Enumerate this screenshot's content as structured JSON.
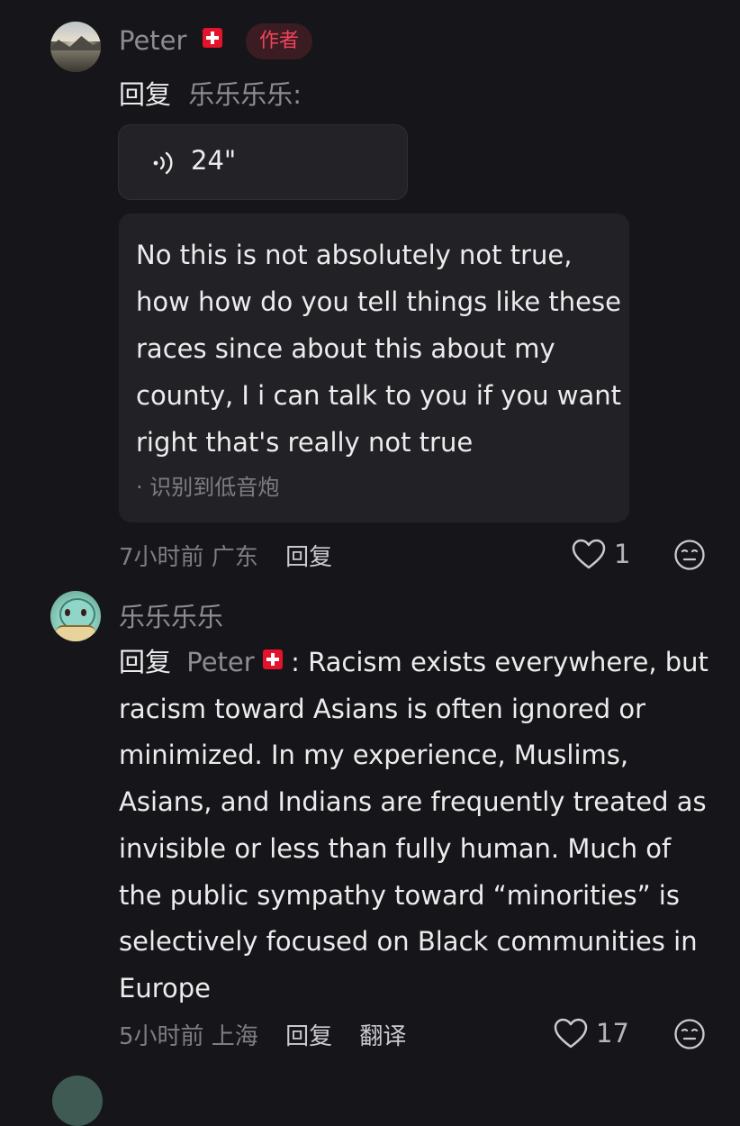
{
  "comments": [
    {
      "username": "Peter",
      "author_badge": "作者",
      "reply_word": "回复",
      "reply_target": "乐乐乐乐:",
      "voice": {
        "duration": "24\""
      },
      "transcript": {
        "text": "No this is not absolutely not true, how how do you tell things like these races since about this about my county, I i can talk to you if you want right that's really not true",
        "note": "· 识别到低音炮"
      },
      "meta": {
        "time_location": "7小时前 广东",
        "reply_label": "回复"
      },
      "likes": "1"
    },
    {
      "username": "乐乐乐乐",
      "reply_word": "回复",
      "reply_target": "Peter",
      "body": " : Racism exists everywhere, but racism toward Asians is often ignored or minimized. In my experience, Muslims, Asians, and Indians are frequently treated as invisible or less than fully human. Much of the public sympathy toward “minorities” is selectively focused on Black communities in Europe",
      "meta": {
        "time_location": "5小时前 上海",
        "reply_label": "回复",
        "translate_label": "翻译"
      },
      "likes": "17"
    }
  ],
  "colors": {
    "background": "#16161a",
    "author_badge_text": "#f0445c",
    "author_badge_bg": "#3b1c22",
    "flag_red": "#e4122a"
  },
  "icons": {
    "flag": "swiss-flag-icon",
    "voice": "sound-wave-icon",
    "like": "heart-outline-icon",
    "emoji": "neutral-face-icon"
  }
}
